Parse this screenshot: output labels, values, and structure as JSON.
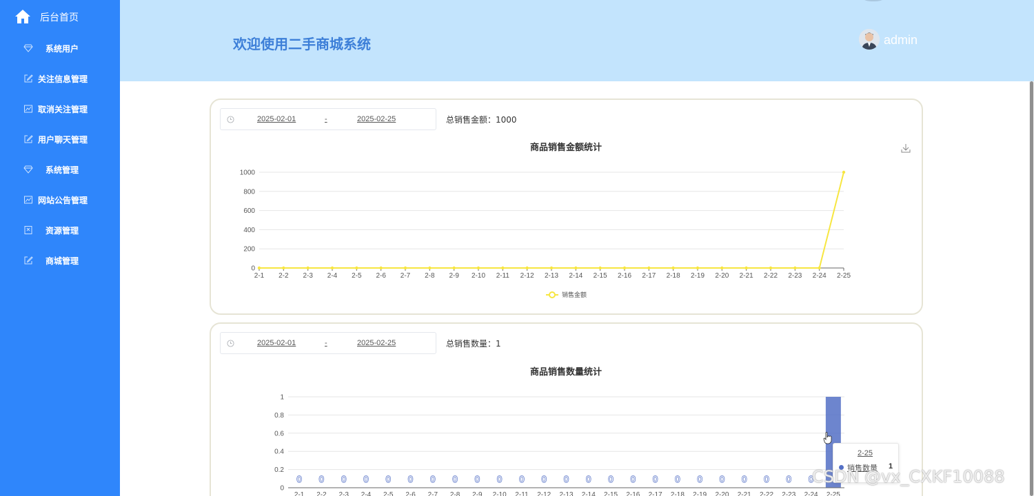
{
  "sidebar": {
    "home_label": "后台首页",
    "items": [
      {
        "label": "系统用户",
        "icon": "diamond-icon"
      },
      {
        "label": "关注信息管理",
        "icon": "edit-icon"
      },
      {
        "label": "取消关注管理",
        "icon": "chart-icon"
      },
      {
        "label": "用户聊天管理",
        "icon": "edit-icon"
      },
      {
        "label": "系统管理",
        "icon": "diamond-icon"
      },
      {
        "label": "网站公告管理",
        "icon": "chart-icon"
      },
      {
        "label": "资源管理",
        "icon": "bookmark-icon"
      },
      {
        "label": "商城管理",
        "icon": "edit-icon"
      }
    ],
    "bg_color": "#2f86fb"
  },
  "header": {
    "title": "欢迎使用二手商城系统",
    "username": "admin",
    "bg_color": "#c3e4fd"
  },
  "amount_panel": {
    "start_date": "2025-02-01",
    "separator": "-",
    "end_date": "2025-02-25",
    "total_label": "总销售金额：1000"
  },
  "quantity_panel": {
    "start_date": "2025-02-01",
    "separator": "-",
    "end_date": "2025-02-25",
    "total_label": "总销售数量：1"
  },
  "tooltip": {
    "title": "2-25",
    "series_name": "销售数量",
    "value": "1"
  },
  "watermark": "CSDN @vx_CXKF10088",
  "chart_data": [
    {
      "type": "line",
      "title": "商品销售金额统计",
      "categories": [
        "2-1",
        "2-2",
        "2-3",
        "2-4",
        "2-5",
        "2-6",
        "2-7",
        "2-8",
        "2-9",
        "2-10",
        "2-11",
        "2-12",
        "2-13",
        "2-14",
        "2-15",
        "2-16",
        "2-17",
        "2-18",
        "2-19",
        "2-20",
        "2-21",
        "2-22",
        "2-23",
        "2-24",
        "2-25"
      ],
      "series": [
        {
          "name": "销售金额",
          "values": [
            0,
            0,
            0,
            0,
            0,
            0,
            0,
            0,
            0,
            0,
            0,
            0,
            0,
            0,
            0,
            0,
            0,
            0,
            0,
            0,
            0,
            0,
            0,
            0,
            1000
          ],
          "color": "#f7e640"
        }
      ],
      "yticks": [
        "0",
        "200",
        "400",
        "600",
        "800",
        "1000"
      ],
      "ylim": [
        0,
        1000
      ],
      "grid": true,
      "legend": "bottom"
    },
    {
      "type": "bar",
      "title": "商品销售数量统计",
      "categories": [
        "2-1",
        "2-2",
        "2-3",
        "2-4",
        "2-5",
        "2-6",
        "2-7",
        "2-8",
        "2-9",
        "2-10",
        "2-11",
        "2-12",
        "2-13",
        "2-14",
        "2-15",
        "2-16",
        "2-17",
        "2-18",
        "2-19",
        "2-20",
        "2-21",
        "2-22",
        "2-23",
        "2-24",
        "2-25"
      ],
      "series": [
        {
          "name": "销售数量",
          "values": [
            0,
            0,
            0,
            0,
            0,
            0,
            0,
            0,
            0,
            0,
            0,
            0,
            0,
            0,
            0,
            0,
            0,
            0,
            0,
            0,
            0,
            0,
            0,
            0,
            1
          ],
          "color": "#5470c6"
        }
      ],
      "data_labels": [
        "0",
        "0",
        "0",
        "0",
        "0",
        "0",
        "0",
        "0",
        "0",
        "0",
        "0",
        "0",
        "0",
        "0",
        "0",
        "0",
        "0",
        "0",
        "0",
        "0",
        "0",
        "0",
        "0",
        "0"
      ],
      "yticks": [
        "0",
        "0.2",
        "0.4",
        "0.6",
        "0.8",
        "1"
      ],
      "ylim": [
        0,
        1
      ],
      "grid": true
    }
  ]
}
